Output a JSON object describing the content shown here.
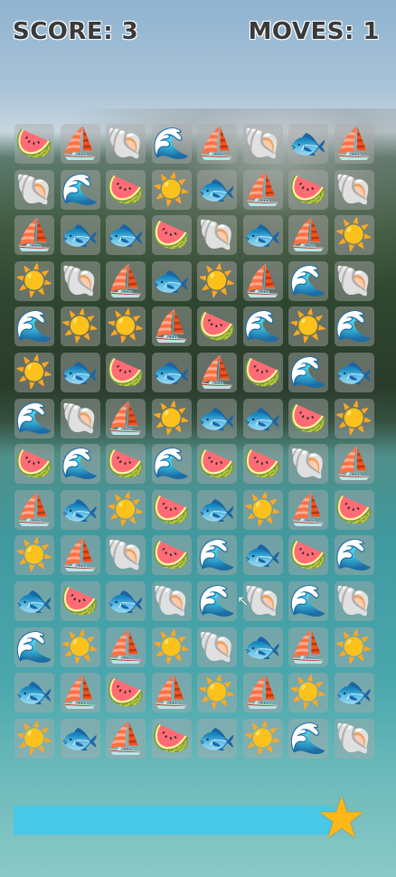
{
  "hud": {
    "score_label": "SCORE: 3",
    "moves_label": "MOVES: 1"
  },
  "icons": {
    "watermelon": "🍉",
    "sailboat": "⛵",
    "shell": "🐚",
    "wave": "🌊",
    "fish": "🐟",
    "sun": "☀️"
  },
  "board": [
    [
      "watermelon",
      "sailboat",
      "shell",
      "wave",
      "sailboat",
      "shell",
      "fish",
      "sailboat"
    ],
    [
      "shell",
      "wave",
      "watermelon",
      "sun",
      "fish",
      "sailboat",
      "watermelon",
      "shell"
    ],
    [
      "sailboat",
      "fish",
      "fish",
      "watermelon",
      "shell",
      "fish",
      "sailboat",
      "sun"
    ],
    [
      "sun",
      "shell",
      "sailboat",
      "fish",
      "sun",
      "sailboat",
      "wave",
      "shell"
    ],
    [
      "wave",
      "sun",
      "sun",
      "sailboat",
      "watermelon",
      "wave",
      "sun",
      "wave"
    ],
    [
      "sun",
      "fish",
      "watermelon",
      "fish",
      "sailboat",
      "watermelon",
      "wave",
      "fish"
    ],
    [
      "wave",
      "shell",
      "sailboat",
      "sun",
      "fish",
      "fish",
      "watermelon",
      "sun"
    ],
    [
      "watermelon",
      "wave",
      "watermelon",
      "wave",
      "watermelon",
      "watermelon",
      "shell",
      "sailboat"
    ],
    [
      "sailboat",
      "fish",
      "sun",
      "watermelon",
      "fish",
      "sun",
      "sailboat",
      "watermelon"
    ],
    [
      "sun",
      "sailboat",
      "shell",
      "watermelon",
      "wave",
      "fish",
      "watermelon",
      "wave"
    ],
    [
      "fish",
      "watermelon",
      "fish",
      "shell",
      "wave",
      "shell",
      "wave",
      "shell"
    ],
    [
      "wave",
      "sun",
      "sailboat",
      "sun",
      "shell",
      "fish",
      "sailboat",
      "sun"
    ],
    [
      "fish",
      "sailboat",
      "watermelon",
      "sailboat",
      "sun",
      "sailboat",
      "sun",
      "fish"
    ],
    [
      "sun",
      "fish",
      "sailboat",
      "watermelon",
      "fish",
      "sun",
      "wave",
      "shell"
    ]
  ],
  "progress": {
    "fraction": 0.85
  },
  "colors": {
    "progress_bar": "#47c8e6",
    "star": "#ffb81a",
    "tile_bg": "rgba(170,170,170,0.45)"
  }
}
